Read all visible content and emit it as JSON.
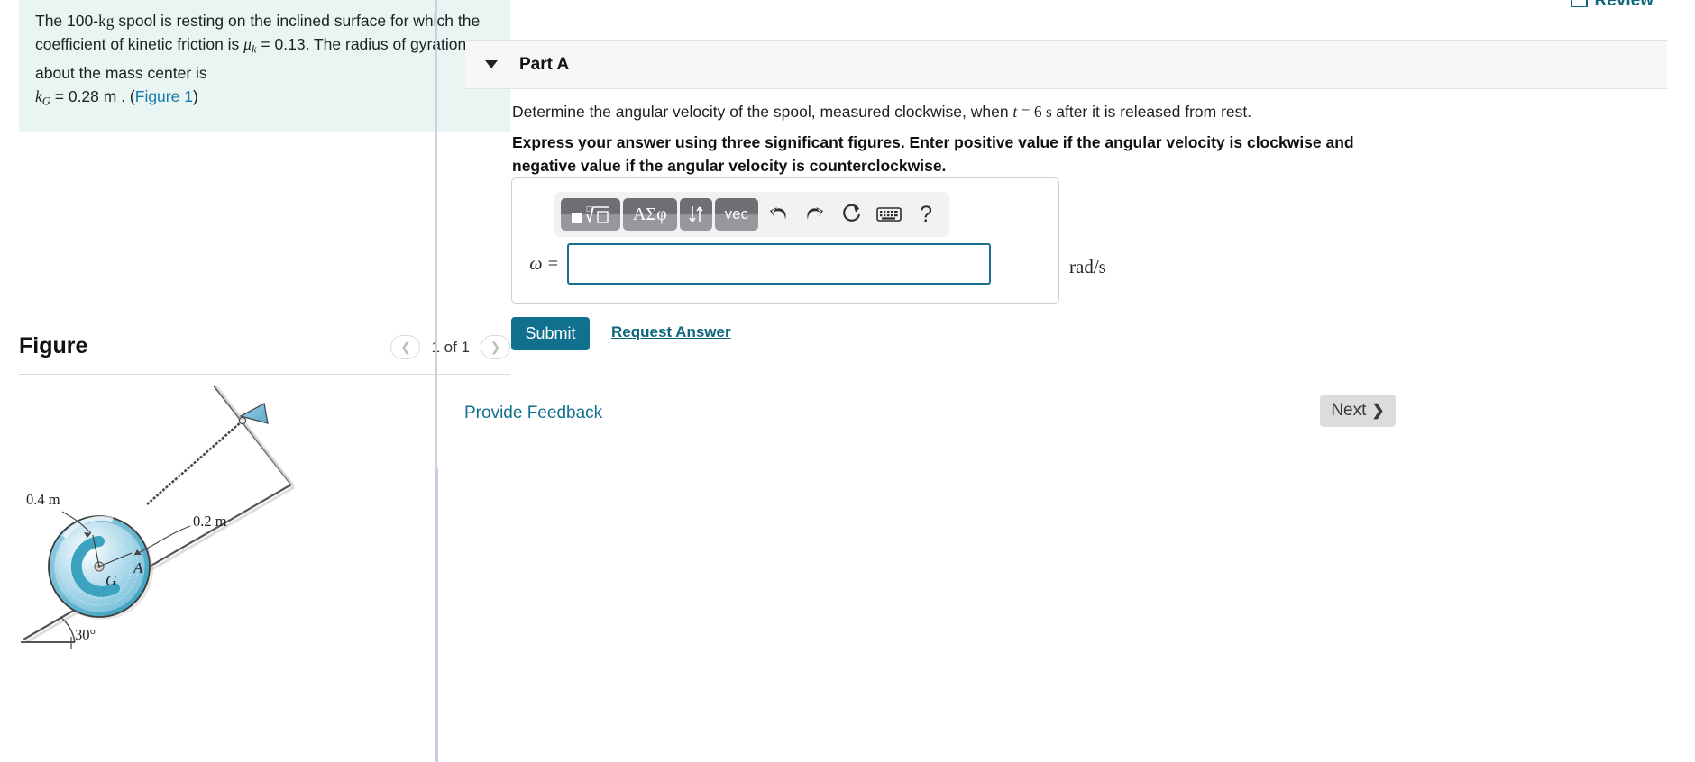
{
  "problem": {
    "line1_a": "The 100-",
    "line1_kg": "kg",
    "line1_b": " spool is resting on the inclined surface for which the coefficient of kinetic friction is ",
    "mu_symbol": "μ",
    "mu_sub": "k",
    "mu_value": " = 0.13. The radius of gyration about the mass center is ",
    "kg_symbol": "k",
    "kg_sub": "G",
    "kg_value": " = 0.28  m . (",
    "figure_link": "Figure 1",
    "closing": ")"
  },
  "figure": {
    "title": "Figure",
    "pager_label": "1 of 1",
    "prev_icon": "chevron-left-icon",
    "next_icon": "chevron-right-icon",
    "labels": {
      "outer_radius": "0.4 m",
      "inner_radius": "0.2 m",
      "contact_point": "A",
      "center": "G",
      "angle": "30°"
    },
    "colors": {
      "spool_light": "#bfe0ef",
      "spool_mid": "#8fcde2",
      "spool_dark": "#3ba3bf",
      "bracket": "#7bbcd8",
      "outline": "#4a4a4a"
    }
  },
  "header": {
    "review_label": "Review",
    "review_icon": "review-icon"
  },
  "part": {
    "title": "Part A",
    "caret_icon": "caret-down-icon",
    "question_a": "Determine the angular velocity of the spool, measured clockwise, when ",
    "question_t": "t",
    "question_eq": " = 6",
    "question_unit": "  s ",
    "question_b": "after it is released from rest.",
    "instruction": "Express your answer using three significant figures. Enter positive value if the angular velocity is clockwise and negative value if the angular velocity is counterclockwise."
  },
  "answer": {
    "variable_label": "ω =",
    "value": "",
    "placeholder": "",
    "unit": "rad/s",
    "toolbar": [
      {
        "name": "template-math-button",
        "label": "▪ⁿ√☐",
        "type": "dark"
      },
      {
        "name": "greek-symbols-button",
        "label": "ΑΣφ",
        "type": "dark"
      },
      {
        "name": "updown-arrows-button",
        "label": "↓↑",
        "type": "dark"
      },
      {
        "name": "vector-button",
        "label": "vec",
        "type": "dark"
      },
      {
        "name": "undo-button",
        "label": "undo-icon",
        "type": "icon"
      },
      {
        "name": "redo-button",
        "label": "redo-icon",
        "type": "icon"
      },
      {
        "name": "reset-button",
        "label": "reset-icon",
        "type": "icon"
      },
      {
        "name": "keyboard-button",
        "label": "keyboard-icon",
        "type": "icon"
      },
      {
        "name": "help-button",
        "label": "?",
        "type": "icon"
      }
    ]
  },
  "actions": {
    "submit_label": "Submit",
    "request_answer_label": "Request Answer",
    "provide_feedback_label": "Provide Feedback",
    "next_label": "Next",
    "next_chevron": "❯"
  },
  "colors": {
    "accent": "#11708e",
    "link": "#11667f",
    "problem_bg": "#e8f5f3",
    "header_bg": "#f7f7f7",
    "input_border": "#17708f",
    "next_bg": "#dcdcdc"
  }
}
